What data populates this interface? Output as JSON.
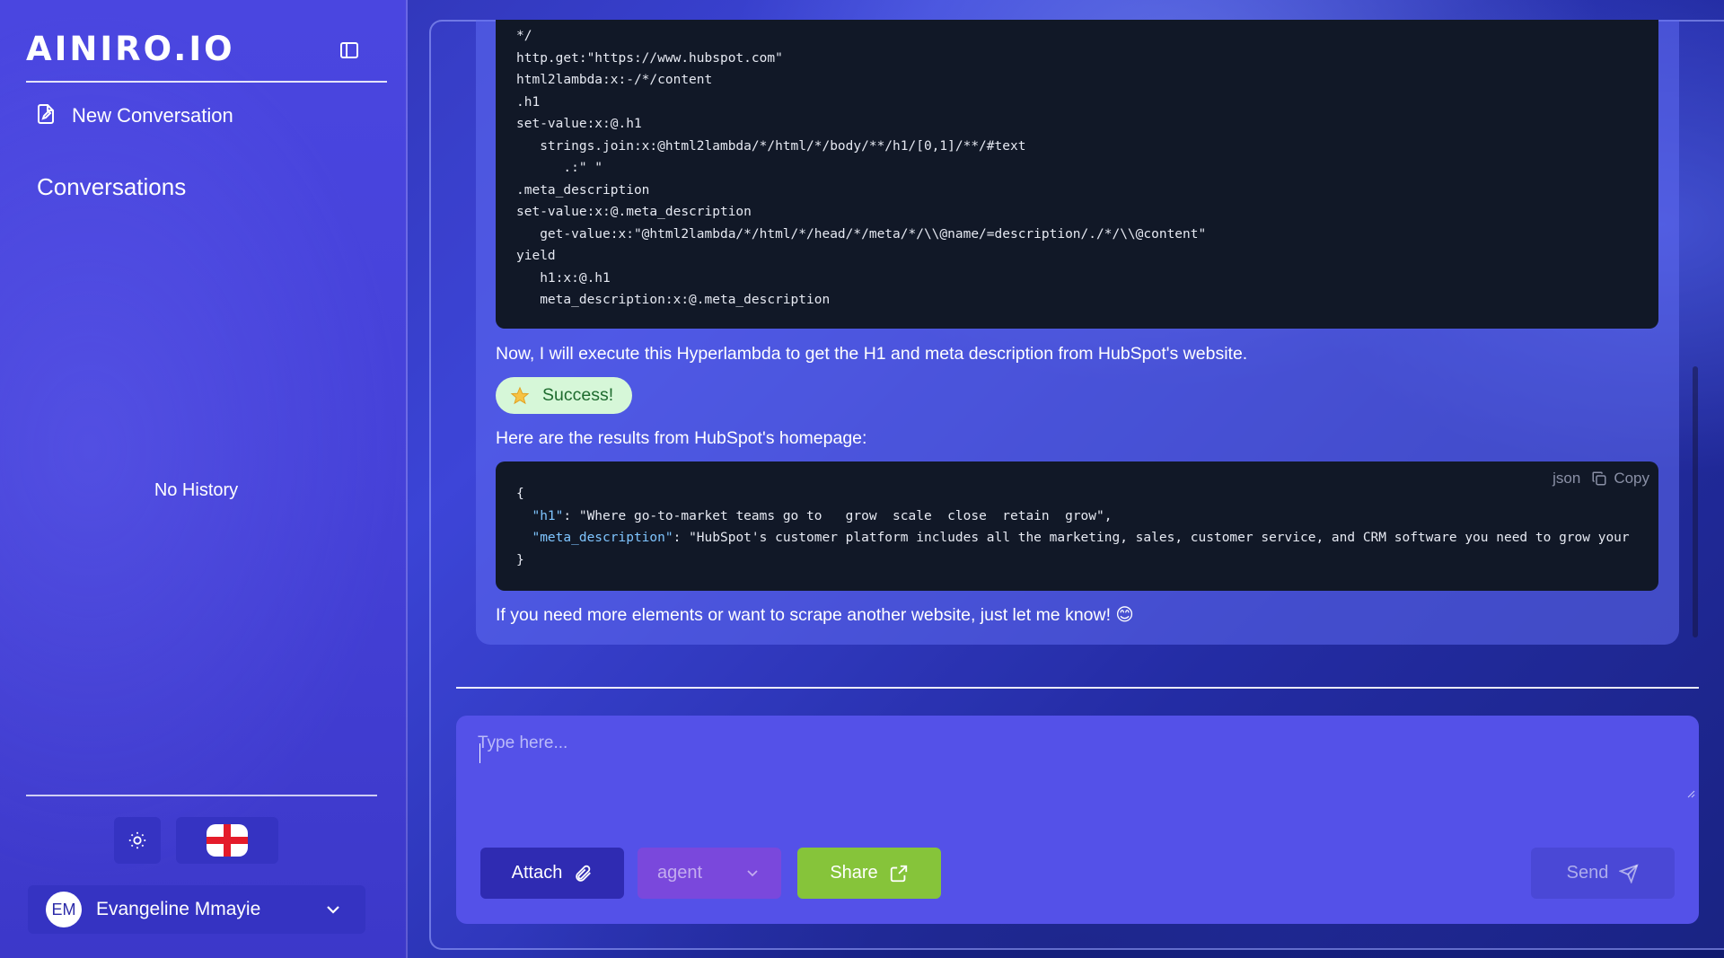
{
  "sidebar": {
    "logo": "AINIRO.IO",
    "new_conversation": "New Conversation",
    "conversations_title": "Conversations",
    "empty_history": "No History",
    "user": {
      "initials": "EM",
      "name": "Evangeline Mmayie"
    }
  },
  "message": {
    "code_hyperlambda": "*/\nhttp.get:\"https://www.hubspot.com\"\nhtml2lambda:x:-/*/content\n.h1\nset-value:x:@.h1\n   strings.join:x:@html2lambda/*/html/*/body/**/h1/[0,1]/**/#text\n      .:\" \"\n.meta_description\nset-value:x:@.meta_description\n   get-value:x:\"@html2lambda/*/html/*/head/*/meta/*/\\\\@name/=description/./*/\\\\@content\"\nyield\n   h1:x:@.h1\n   meta_description:x:@.meta_description",
    "text_execute": "Now, I will execute this Hyperlambda to get the H1 and meta description from HubSpot's website.",
    "success_label": "Success!",
    "text_results": "Here are the results from HubSpot's homepage:",
    "json_block": {
      "language": "json",
      "copy_label": "Copy",
      "open": "{",
      "h1_key": "\"h1\"",
      "h1_value": ": \"Where go-to-market teams go to   grow  scale  close  retain  grow\",",
      "meta_key": "\"meta_description\"",
      "meta_value": ": \"HubSpot's customer platform includes all the marketing, sales, customer service, and CRM software you need to grow your",
      "close": "}"
    },
    "text_followup": "If you need more elements or want to scrape another website, just let me know! 😊"
  },
  "composer": {
    "placeholder": "Type here...",
    "attach_label": "Attach",
    "agent_label": "agent",
    "share_label": "Share",
    "send_label": "Send"
  },
  "icons": {
    "sidebar_toggle": "sidebar-toggle-icon",
    "new_conversation": "file-edit-icon",
    "theme": "sun-icon",
    "language": "england-flag-icon",
    "user_menu": "chevron-down-icon",
    "success": "star-icon",
    "copy": "copy-icon",
    "attach": "paperclip-icon",
    "agent": "chevron-down-icon",
    "share": "external-share-icon",
    "send": "paper-plane-icon"
  },
  "colors": {
    "sidebar_bg": "#4a46e0",
    "code_bg": "#111827",
    "composer_bg": "#5451e8",
    "attach_bg": "#2f2bb2",
    "agent_bg": "#7a48dc",
    "share_bg": "#86c43a",
    "success_bg": "#d6f7d8"
  }
}
